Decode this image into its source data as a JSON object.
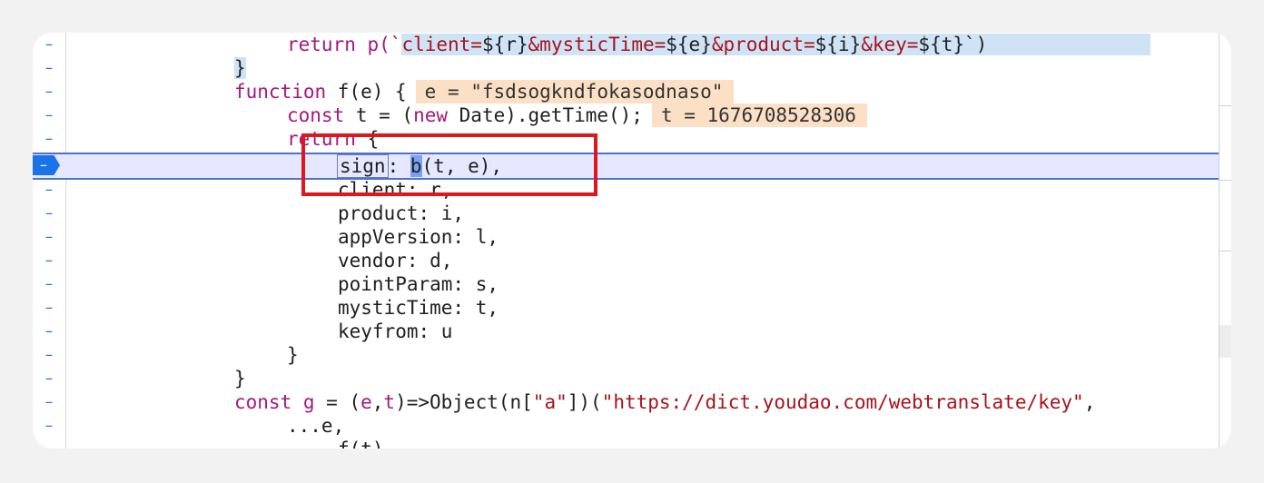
{
  "editor": {
    "marker": "–",
    "lines": [
      {
        "parts": [
          "return p(`",
          "client=",
          "${r}",
          "&mysticTime=",
          "${e}",
          "&product=",
          "${i}",
          "&key=",
          "${t}",
          "`)"
        ]
      },
      {
        "parts": [
          "}"
        ]
      },
      {
        "parts": [
          "function",
          " f(e) {"
        ],
        "inline": "e = \"fsdsogkndfokasodnaso\""
      },
      {
        "parts": [
          "const",
          " t = (",
          "new",
          " Date).getTime();"
        ],
        "inline": "t = 1676708528306"
      },
      {
        "parts": [
          "return",
          " {"
        ]
      },
      {
        "parts": [
          "sign",
          ": ",
          "b",
          "(t, e),"
        ]
      },
      {
        "parts": [
          "client: r,"
        ]
      },
      {
        "parts": [
          "product: i,"
        ]
      },
      {
        "parts": [
          "appVersion: l,"
        ]
      },
      {
        "parts": [
          "vendor: d,"
        ]
      },
      {
        "parts": [
          "pointParam: s,"
        ]
      },
      {
        "parts": [
          "mysticTime: t,"
        ]
      },
      {
        "parts": [
          "keyfrom: u"
        ]
      },
      {
        "parts": [
          "}"
        ]
      },
      {
        "parts": [
          "}"
        ]
      },
      {
        "parts": [
          "const",
          " ",
          "g",
          " = (",
          "e",
          ",",
          "t",
          ")=>Object(n[",
          "\"a\"",
          "])(",
          "\"https://dict.youdao.com/webtranslate/key\"",
          ","
        ]
      },
      {
        "parts": [
          "...e,"
        ]
      },
      {
        "parts": [
          "f(t),"
        ]
      }
    ]
  },
  "colors": {
    "keyword": "#a3187f",
    "string": "#a8121a",
    "breakpoint": "#1a73e8",
    "highlight_box": "#e0161c"
  }
}
